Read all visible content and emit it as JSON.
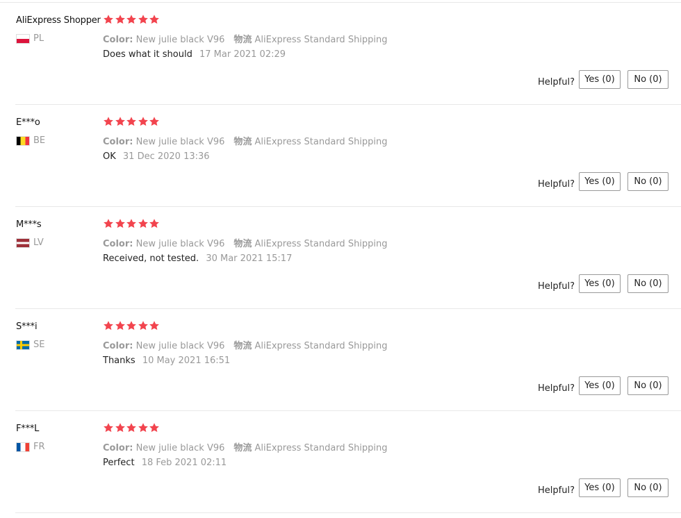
{
  "reviews": [
    {
      "user": "AliExpress Shopper",
      "country": "PL",
      "flag": [
        "#ffffff",
        "#dc143c"
      ],
      "flag_type": "h2",
      "stars": 5,
      "sku": [
        {
          "key": "Color:",
          "value": "New julie black V96"
        },
        {
          "key": "物流",
          "value": "AliExpress Standard Shipping"
        }
      ],
      "text": "Does what it should",
      "date": "17 Mar 2021 02:29",
      "helpful_label": "Helpful?",
      "yes_label": "Yes (0)",
      "no_label": "No (0)"
    },
    {
      "user": "E***o",
      "country": "BE",
      "flag": [
        "#000000",
        "#fdda24",
        "#ef3340"
      ],
      "flag_type": "v3",
      "stars": 5,
      "sku": [
        {
          "key": "Color:",
          "value": "New julie black V96"
        },
        {
          "key": "物流",
          "value": "AliExpress Standard Shipping"
        }
      ],
      "text": "OK",
      "date": "31 Dec 2020 13:36",
      "helpful_label": "Helpful?",
      "yes_label": "Yes (0)",
      "no_label": "No (0)"
    },
    {
      "user": "M***s",
      "country": "LV",
      "flag": [
        "#9e3039",
        "#ffffff",
        "#9e3039"
      ],
      "flag_type": "lv",
      "stars": 5,
      "sku": [
        {
          "key": "Color:",
          "value": "New julie black V96"
        },
        {
          "key": "物流",
          "value": "AliExpress Standard Shipping"
        }
      ],
      "text": "Received, not tested.",
      "date": "30 Mar 2021 15:17",
      "helpful_label": "Helpful?",
      "yes_label": "Yes (0)",
      "no_label": "No (0)"
    },
    {
      "user": "S***i",
      "country": "SE",
      "flag": [
        "#006aa7",
        "#fecc00"
      ],
      "flag_type": "nordic",
      "stars": 5,
      "sku": [
        {
          "key": "Color:",
          "value": "New julie black V96"
        },
        {
          "key": "物流",
          "value": "AliExpress Standard Shipping"
        }
      ],
      "text": "Thanks",
      "date": "10 May 2021 16:51",
      "helpful_label": "Helpful?",
      "yes_label": "Yes (0)",
      "no_label": "No (0)"
    },
    {
      "user": "F***L",
      "country": "FR",
      "flag": [
        "#0055a4",
        "#ffffff",
        "#ef4135"
      ],
      "flag_type": "v3",
      "stars": 5,
      "sku": [
        {
          "key": "Color:",
          "value": "New julie black V96"
        },
        {
          "key": "物流",
          "value": "AliExpress Standard Shipping"
        }
      ],
      "text": "Perfect",
      "date": "18 Feb 2021 02:11",
      "helpful_label": "Helpful?",
      "yes_label": "Yes (0)",
      "no_label": "No (0)"
    }
  ],
  "colors": {
    "star": "#f2444e",
    "divider": "#e8e8e8",
    "muted_text": "#999999"
  }
}
